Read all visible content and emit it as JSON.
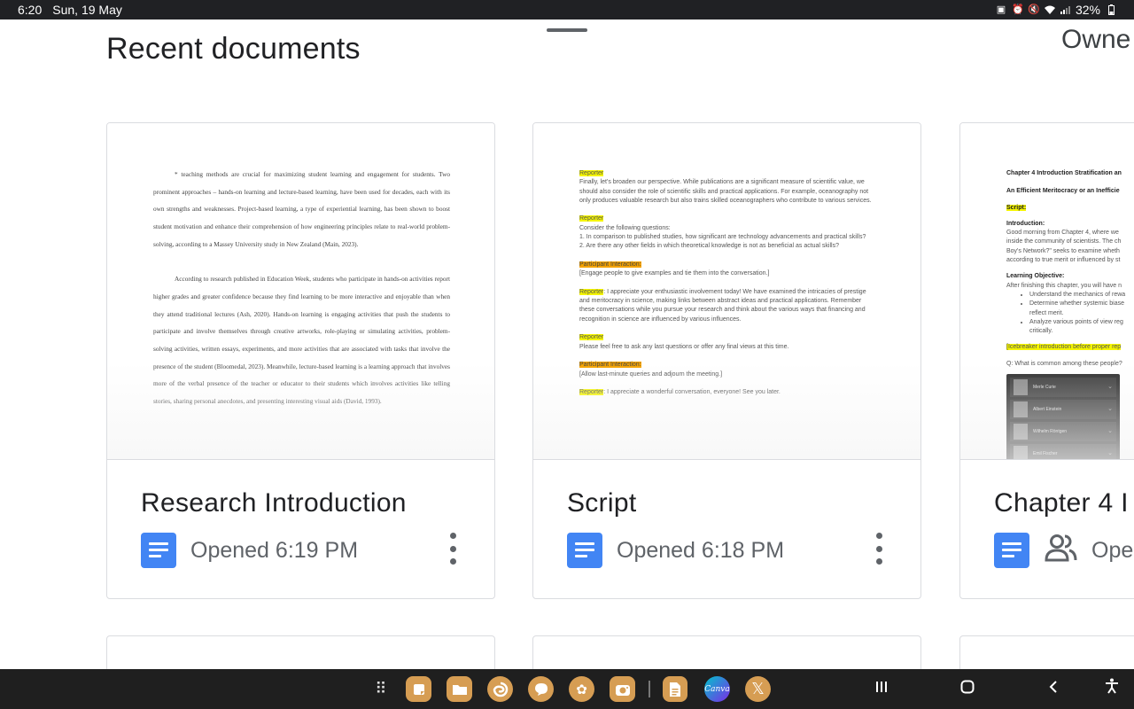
{
  "status_bar": {
    "time": "6:20",
    "date": "Sun, 19 May",
    "battery": "32%",
    "icons": [
      "battery-saver-icon",
      "alarm-icon",
      "mute-icon",
      "wifi-icon",
      "signal-icon",
      "battery-icon"
    ]
  },
  "header": {
    "title": "Recent documents",
    "owner_column": "Owne"
  },
  "documents": [
    {
      "name": "Research Introduction",
      "opened": "Opened 6:19 PM",
      "icon": "google-docs-icon",
      "preview": {
        "paragraphs": [
          "* teaching methods are crucial for maximizing student learning and engagement for students. Two prominent approaches – hands-on learning and lecture-based learning, have been used for decades, each with its own strengths and weaknesses. Project-based learning, a type of experiential learning, has been shown to boost student motivation and enhance their comprehension of how engineering principles relate to real-world problem-solving, according to a Massey University study in New Zealand (Main, 2023).",
          "According to research published in Education Week, students who participate in hands-on activities report higher grades and greater confidence because they find learning to be more interactive and enjoyable than when they attend traditional lectures (Ash, 2020). Hands-on learning is engaging activities that push the students to participate and involve themselves through creative artworks, role-playing or simulating activities, problem-solving activities, written essays, experiments, and more activities that are associated with tasks that involve the presence of the student (Bloomedal, 2023). Meanwhile, lecture-based learning is a learning approach that involves more of the verbal presence of the teacher or educator to their students which involves activities like telling stories, sharing personal anecdotes, and presenting interesting visual aids (David, 1993)."
        ]
      }
    },
    {
      "name": "Script",
      "opened": "Opened 6:18 PM",
      "icon": "google-docs-icon",
      "preview": {
        "blocks": [
          {
            "tag": "Reporter",
            "tag_color": "yellow",
            "text": "Finally, let's broaden our perspective. While publications are a significant measure of scientific value, we should also consider the role of scientific skills and practical applications. For example, oceanography not only produces valuable research but also trains skilled oceanographers who contribute to various services."
          },
          {
            "tag": "Reporter",
            "tag_color": "yellow",
            "text": "Consider the following questions:\n1. In comparison to published studies, how significant are technology advancements and practical skills?\n2. Are there any other fields in which theoretical knowledge is not as beneficial as actual skills?"
          },
          {
            "tag": "Participant Interaction:",
            "tag_color": "orange",
            "text": "[Engage people to give examples and tie them into the conversation.]"
          },
          {
            "tag": "Reporter",
            "tag_color": "yellow",
            "inline": true,
            "text": ": I appreciate your enthusiastic involvement today! We have examined the intricacies of prestige and meritocracy in science, making links between abstract ideas and practical applications. Remember these conversations while you pursue your research and think about the various ways that financing and recognition in science are influenced by various influences."
          },
          {
            "tag": "Reporter",
            "tag_color": "yellow",
            "text": "Please feel free to ask any last questions or offer any final views at this time."
          },
          {
            "tag": "Participant Interaction:",
            "tag_color": "orange",
            "text": " [Allow last-minute queries and adjourn the meeting.]"
          },
          {
            "tag": "Reporter",
            "tag_color": "yellow",
            "inline": true,
            "text": ": I appreciate a wonderful conversation, everyone! See you later."
          }
        ]
      }
    },
    {
      "name": "Chapter 4 I",
      "opened": "Open",
      "icon": "google-docs-icon",
      "shared_icon": "shared-people-icon",
      "preview": {
        "heading": "Chapter 4 Introduction Stratification an",
        "subheading": "An Efficient Meritocracy or an Inefficie",
        "script_tag": "Script:",
        "intro_title": "Introduction:",
        "intro_text": "Good morning from Chapter 4, where we inside the community of scientists. The ch Boy's Network?\" seeks to examine wheth according to true merit or influenced by st",
        "objective_title": "Learning Objective:",
        "objective_text": "After finishing this chapter, you will have n",
        "bullets": [
          "Understand the mechanics of rewa",
          "Determine whether systemic biase reflect merit.",
          "Analyze various points of view reg critically."
        ],
        "icebreaker": "[Icebreaker introduction before proper rep",
        "question": "Q: What is common among these people?",
        "people": [
          "Merle Curie",
          "Albert Einstein",
          "Wilhelm Röntgen",
          "Emil Fischer"
        ]
      }
    }
  ],
  "taskbar": {
    "apps": [
      "apps-grid-icon",
      "samsung-notes-icon",
      "my-files-icon",
      "edge-browser-icon",
      "messages-icon",
      "gallery-icon",
      "camera-icon",
      "docs-icon",
      "canva-icon",
      "x-icon"
    ],
    "canva_label": "Canva",
    "nav": [
      "recents-icon",
      "home-icon",
      "back-icon",
      "accessibility-icon"
    ]
  }
}
